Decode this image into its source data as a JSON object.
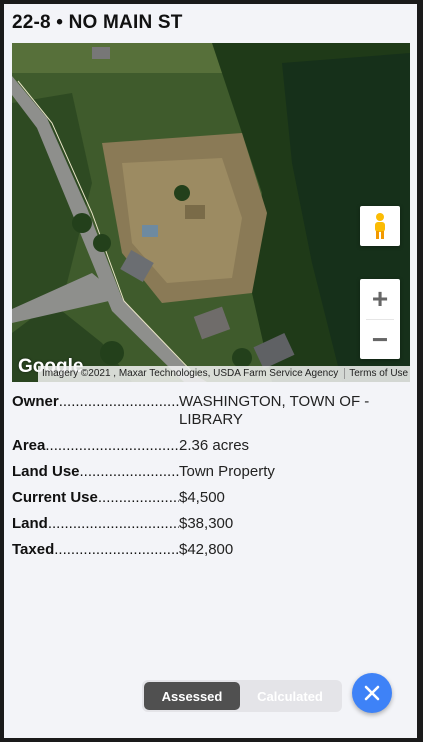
{
  "title": "22-8 • NO MAIN ST",
  "map": {
    "logo_text": "Google",
    "attribution": "Imagery ©2021 , Maxar Technologies, USDA Farm Service Agency",
    "terms": "Terms of Use",
    "zoom_in": "+",
    "zoom_out": "−",
    "icons": {
      "pegman": "street-view-pegman-icon",
      "close": "close-icon"
    }
  },
  "details": [
    {
      "label": "Owner",
      "value": "WASHINGTON, TOWN OF - LIBRARY"
    },
    {
      "label": "Area",
      "value": "2.36 acres"
    },
    {
      "label": "Land Use",
      "value": "Town Property"
    },
    {
      "label": "Current Use",
      "value": "$4,500"
    },
    {
      "label": "Land",
      "value": "$38,300"
    },
    {
      "label": "Taxed",
      "value": "$42,800"
    }
  ],
  "toggle": {
    "assessed": "Assessed",
    "calculated": "Calculated",
    "selected": "Assessed"
  },
  "colors": {
    "fab": "#3e82f7",
    "toggle_active": "#505050",
    "background": "#f3f4f8"
  }
}
